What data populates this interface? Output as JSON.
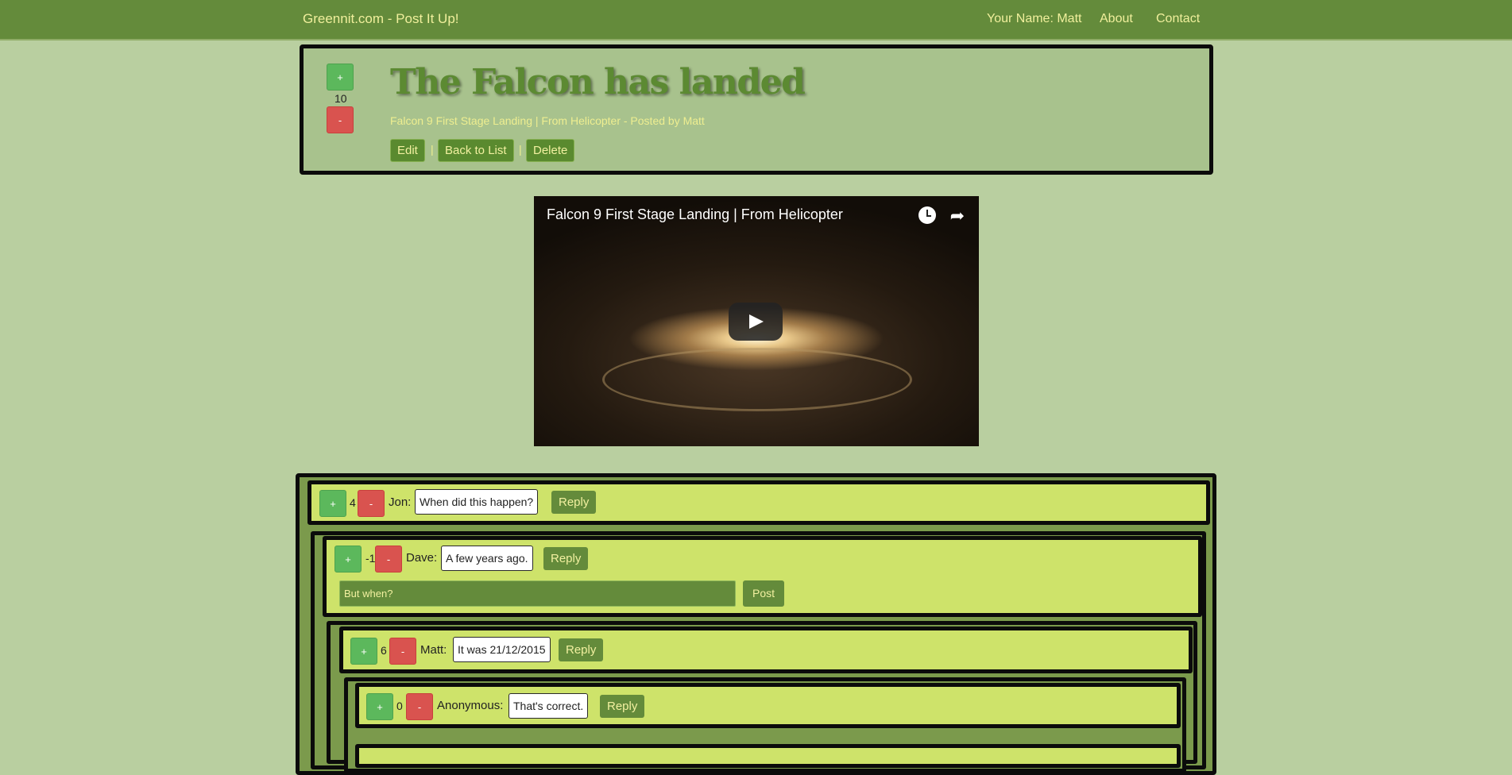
{
  "navbar": {
    "brand": "Greennit.com - Post It Up!",
    "user": "Your Name: Matt",
    "about": "About",
    "contact": "Contact"
  },
  "post": {
    "upvote": "+",
    "downvote": "-",
    "score": "10",
    "title": "The Falcon has landed",
    "meta": "Falcon 9 First Stage Landing | From Helicopter - Posted by Matt",
    "edit": "Edit",
    "back": "Back to List",
    "delete": "Delete",
    "separator": "|"
  },
  "video": {
    "title": "Falcon 9 First Stage Landing | From Helicopter",
    "icons": [
      "clock-icon",
      "share-icon",
      "play-icon"
    ]
  },
  "comments": [
    {
      "author": "Jon:",
      "score": "4",
      "text": "When did this happen?",
      "upvote": "+",
      "downvote": "-",
      "reply": "Reply"
    },
    {
      "author": "Dave:",
      "score": "-1",
      "text": "A few years ago.",
      "upvote": "+",
      "downvote": "-",
      "reply": "Reply"
    },
    {
      "author": "Matt:",
      "score": "6",
      "text": "It was 21/12/2015",
      "upvote": "+",
      "downvote": "-",
      "reply": "Reply"
    },
    {
      "author": "Anonymous:",
      "score": "0",
      "text": "That's correct.",
      "upvote": "+",
      "downvote": "-",
      "reply": "Reply"
    }
  ],
  "reply_form": {
    "value": "But when?",
    "post": "Post"
  },
  "colors": {
    "page": "#b9cfa0",
    "navbar": "#648b3b",
    "comment": "#cee36a",
    "upvote": "#5cb85c",
    "downvote": "#d9534f"
  }
}
